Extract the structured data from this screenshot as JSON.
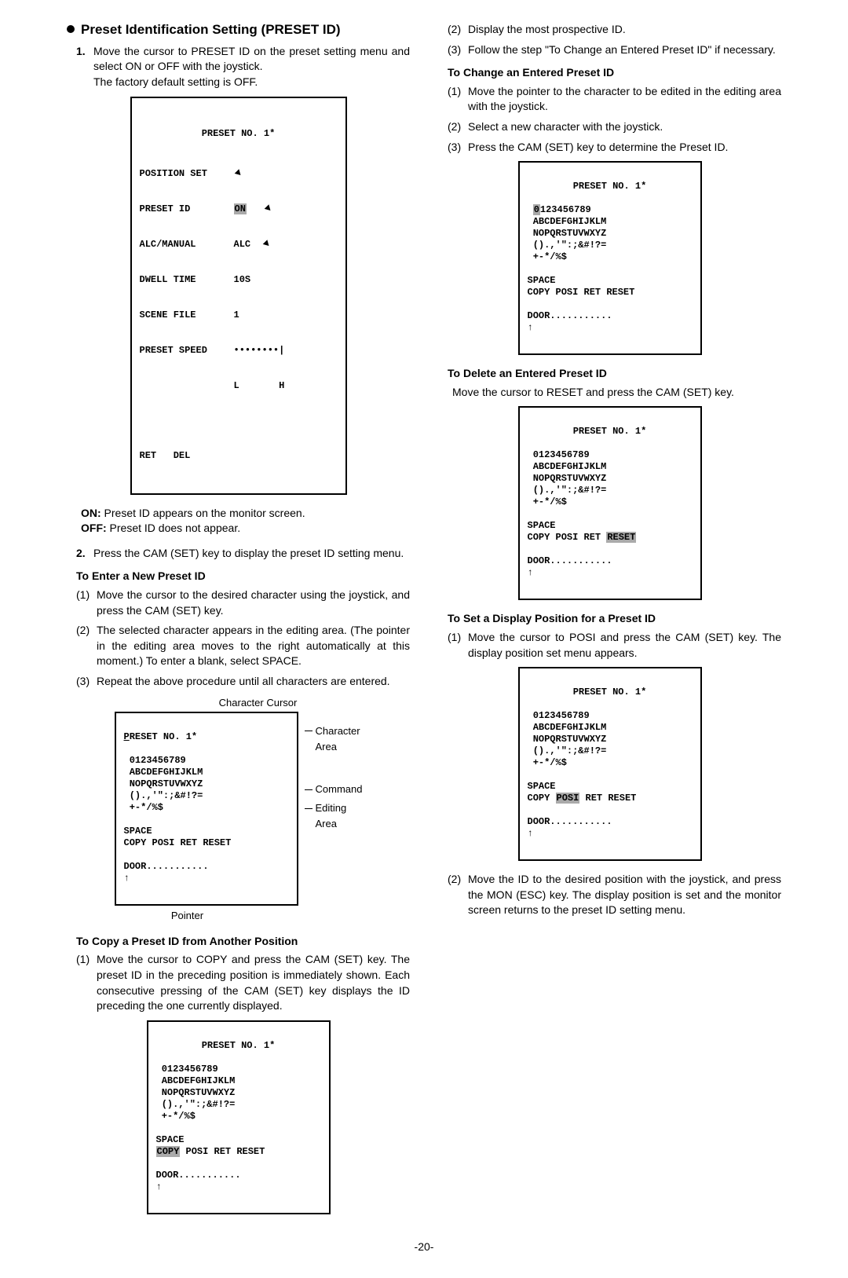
{
  "left": {
    "h1": "Preset Identification Setting (PRESET ID)",
    "step1a": "Move the cursor to PRESET ID on the preset setting menu and select ON or OFF with the joystick.",
    "step1b": "The factory default setting is OFF.",
    "m1": {
      "title": "PRESET NO. 1*",
      "r1l": "POSITION SET",
      "r1v": "",
      "r2l": "PRESET ID",
      "r2v": "ON",
      "r3l": "ALC/MANUAL",
      "r3v": "ALC",
      "r4l": "DWELL TIME",
      "r4v": "10S",
      "r5l": "SCENE FILE",
      "r5v": "1",
      "r6l": "PRESET SPEED",
      "r6v": "••••••••|",
      "r7l": "",
      "r7v": "L       H",
      "footl": "RET   DEL"
    },
    "onoff": {
      "on_b": "ON:",
      "on_t": " Preset ID appears on the monitor screen.",
      "off_b": "OFF:",
      "off_t": " Preset ID does not appear."
    },
    "step2": "Press the CAM (SET) key to display the preset ID setting menu.",
    "h2a": "To Enter a New Preset ID",
    "a1": "Move the cursor to the desired character using the joystick, and press the CAM (SET) key.",
    "a2": "The selected character appears in the editing area. (The pointer in the editing area moves to the right automatically at this moment.) To enter a blank, select SPACE.",
    "a3": "Repeat the above procedure until all characters are entered.",
    "diag": {
      "toplabel": "Character Cursor",
      "l1": "Character",
      "l1b": "Area",
      "l2": "Command",
      "l3": "Editing",
      "l3b": "Area",
      "bottom": "Pointer"
    },
    "h2b": "To Copy a Preset ID from Another Position",
    "b1": "Move the cursor to COPY and press the CAM (SET) key. The preset ID in the preceding position is immediately shown. Each consecutive pressing of the CAM (SET) key displays the ID preceding the one currently displayed."
  },
  "right": {
    "r2": "Display the most prospective ID.",
    "r3": "Follow the step \"To Change an Entered Preset ID\" if necessary.",
    "h2c": "To Change an Entered Preset ID",
    "c1": "Move the pointer to the character to be edited in the editing area with the joystick.",
    "c2": "Select a new character with the joystick.",
    "c3": "Press the CAM (SET) key to determine the Preset ID.",
    "h2d": "To Delete an Entered Preset ID",
    "d1": "Move the cursor to RESET and press the CAM (SET) key.",
    "h2e": "To Set a Display Position for a Preset ID",
    "e1": "Move the cursor to POSI and press the CAM (SET) key. The display position set menu appears.",
    "r_end": "Move the ID to the desired position with the joystick, and press the MON (ESC) key. The display position is set and the monitor screen returns to the preset ID setting menu."
  },
  "m2": {
    "t": "PRESET NO. 1*",
    "l1": " 0123456789",
    "l2": " ABCDEFGHIJKLM",
    "l3": " NOPQRSTUVWXYZ",
    "l4": " ().,'\":;&#!?=",
    "l5": " +-*/%$",
    "sp": "SPACE",
    "cmd": "COPY POSI RET RESET",
    "edit": "DOOR...........",
    "pointer": "↑"
  },
  "pagenum": "-20-"
}
